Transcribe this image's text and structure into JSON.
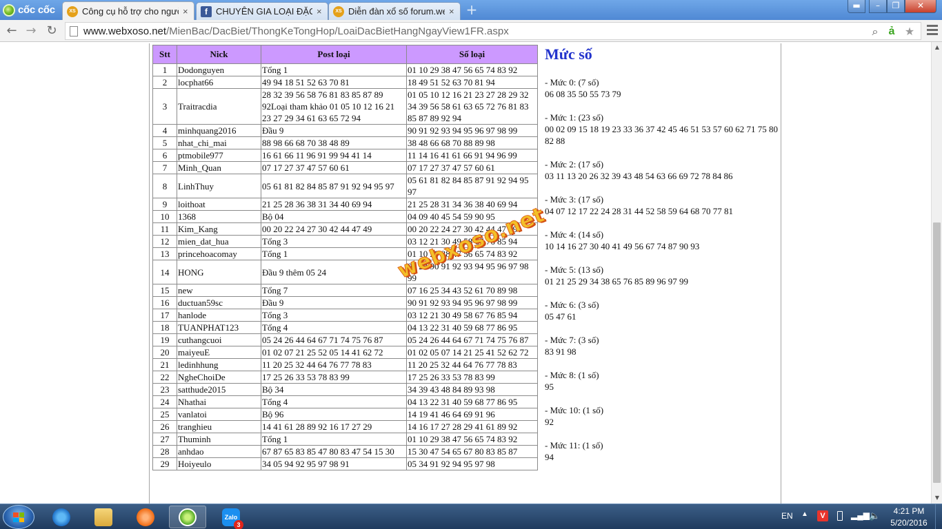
{
  "browser": {
    "brand": "cốc cốc",
    "tabs": [
      {
        "title": "Công cụ hỗ trợ cho người",
        "favicon": "XS",
        "active": true
      },
      {
        "title": "CHUYÊN GIA LOẠI ĐẶC BI",
        "favicon": "f",
        "active": false
      },
      {
        "title": "Diễn đàn xổ số forum.web",
        "favicon": "XS",
        "active": false
      }
    ],
    "url_host": "www.webxoso.net",
    "url_path": "/MienBac/DacBiet/ThongKeTongHop/LoaiDacBietHangNgayView1FR.aspx"
  },
  "table": {
    "headers": [
      "Stt",
      "Nick",
      "Post loại",
      "Số loại"
    ],
    "rows": [
      {
        "stt": "1",
        "nick": "Dodonguyen",
        "post": "Tổng 1",
        "so": "01 10 29 38 47 56 65 74 83 92"
      },
      {
        "stt": "2",
        "nick": "locphat66",
        "post": "49 94 18 51 52 63 70 81",
        "so": "18 49 51 52 63 70 81 94"
      },
      {
        "stt": "3",
        "nick": "Traitracdia",
        "post": "28 32 39 56 58 76 81 83 85 87 89 92Loại tham khảo 01 05 10 12 16 21 23 27 29 34 61 63 65 72 94",
        "so": "01 05 10 12 16 21 23 27 28 29 32 34 39 56 58 61 63 65 72 76 81 83 85 87 89 92 94"
      },
      {
        "stt": "4",
        "nick": "minhquang2016",
        "post": "Đầu 9",
        "so": "90 91 92 93 94 95 96 97 98 99"
      },
      {
        "stt": "5",
        "nick": "nhat_chi_mai",
        "post": "88 98 66 68 70 38 48 89",
        "so": "38 48 66 68 70 88 89 98"
      },
      {
        "stt": "6",
        "nick": "ptmobile977",
        "post": "16 61 66 11 96 91 99 94 41 14",
        "so": "11 14 16 41 61 66 91 94 96 99"
      },
      {
        "stt": "7",
        "nick": "Minh_Quan",
        "post": "07 17 27 37 47 57 60 61",
        "so": "07 17 27 37 47 57 60 61"
      },
      {
        "stt": "8",
        "nick": "LinhThuy",
        "post": "05 61 81 82 84 85 87 91 92 94 95 97",
        "so": "05 61 81 82 84 85 87 91 92 94 95 97"
      },
      {
        "stt": "9",
        "nick": "loithoat",
        "post": "21 25 28 36 38 31 34 40 69 94",
        "so": "21 25 28 31 34 36 38 40 69 94"
      },
      {
        "stt": "10",
        "nick": "1368",
        "post": "Bộ 04",
        "so": "04 09 40 45 54 59 90 95"
      },
      {
        "stt": "11",
        "nick": "Kim_Kang",
        "post": "00 20 22 24 27 30 42 44 47 49",
        "so": "00 20 22 24 27 30 42 44 47 49"
      },
      {
        "stt": "12",
        "nick": "mien_dat_hua",
        "post": "Tổng 3",
        "so": "03 12 21 30 49 58 67 76 85 94"
      },
      {
        "stt": "13",
        "nick": "princehoacomay",
        "post": "Tổng 1",
        "so": "01 10 29 38 47 56 65 74 83 92"
      },
      {
        "stt": "14",
        "nick": "HONG",
        "post": "Đầu 9 thêm 05 24",
        "so": "05 24 90 91 92 93 94 95 96 97 98 99"
      },
      {
        "stt": "15",
        "nick": "new",
        "post": "Tổng 7",
        "so": "07 16 25 34 43 52 61 70 89 98"
      },
      {
        "stt": "16",
        "nick": "ductuan59sc",
        "post": "Đầu 9",
        "so": "90 91 92 93 94 95 96 97 98 99"
      },
      {
        "stt": "17",
        "nick": "hanlode",
        "post": "Tổng 3",
        "so": "03 12 21 30 49 58 67 76 85 94"
      },
      {
        "stt": "18",
        "nick": "TUANPHAT123",
        "post": "Tổng 4",
        "so": "04 13 22 31 40 59 68 77 86 95"
      },
      {
        "stt": "19",
        "nick": "cuthangcuoi",
        "post": "05 24 26 44 64 67 71 74 75 76 87",
        "so": "05 24 26 44 64 67 71 74 75 76 87"
      },
      {
        "stt": "20",
        "nick": "maiyeuE",
        "post": "01 02 07 21 25 52 05 14 41 62 72",
        "so": "01 02 05 07 14 21 25 41 52 62 72"
      },
      {
        "stt": "21",
        "nick": "ledinhhung",
        "post": "11 20 25 32 44 64 76 77 78 83",
        "so": "11 20 25 32 44 64 76 77 78 83"
      },
      {
        "stt": "22",
        "nick": "NgheChoiDe",
        "post": "17 25 26 33 53 78 83 99",
        "so": "17 25 26 33 53 78 83 99"
      },
      {
        "stt": "23",
        "nick": "satthude2015",
        "post": "Bộ 34",
        "so": "34 39 43 48 84 89 93 98"
      },
      {
        "stt": "24",
        "nick": "Nhathai",
        "post": "Tổng 4",
        "so": "04 13 22 31 40 59 68 77 86 95"
      },
      {
        "stt": "25",
        "nick": "vanlatoi",
        "post": "Bộ 96",
        "so": "14 19 41 46 64 69 91 96"
      },
      {
        "stt": "26",
        "nick": "tranghieu",
        "post": "14 41 61 28 89 92 16 17 27 29",
        "so": "14 16 17 27 28 29 41 61 89 92"
      },
      {
        "stt": "27",
        "nick": "Thuminh",
        "post": "Tổng 1",
        "so": "01 10 29 38 47 56 65 74 83 92"
      },
      {
        "stt": "28",
        "nick": "anhdao",
        "post": "67 87 65 83 85 47 80 83 47 54 15 30",
        "so": "15 30 47 54 65 67 80 83 85 87"
      },
      {
        "stt": "29",
        "nick": "Hoiyeulo",
        "post": "34 05 94 92 95 97 98 91",
        "so": "05 34 91 92 94 95 97 98"
      }
    ]
  },
  "muc": {
    "title": "Mức số",
    "items": [
      {
        "label": "- Mức 0: (7 số)",
        "numbers": "06 08 35 50 55 73 79"
      },
      {
        "label": "- Mức 1: (23 số)",
        "numbers": "00 02 09 15 18 19 23 33 36 37 42 45 46 51 53 57 60 62 71 75 80 82 88"
      },
      {
        "label": "- Mức 2: (17 số)",
        "numbers": "03 11 13 20 26 32 39 43 48 54 63 66 69 72 78 84 86"
      },
      {
        "label": "- Mức 3: (17 số)",
        "numbers": "04 07 12 17 22 24 28 31 44 52 58 59 64 68 70 77 81"
      },
      {
        "label": "- Mức 4: (14 số)",
        "numbers": "10 14 16 27 30 40 41 49 56 67 74 87 90 93"
      },
      {
        "label": "- Mức 5: (13 số)",
        "numbers": "01 21 25 29 34 38 65 76 85 89 96 97 99"
      },
      {
        "label": "- Mức 6: (3 số)",
        "numbers": "05 47 61"
      },
      {
        "label": "- Mức 7: (3 số)",
        "numbers": "83 91 98"
      },
      {
        "label": "- Mức 8: (1 số)",
        "numbers": "95"
      },
      {
        "label": "- Mức 10: (1 số)",
        "numbers": "92"
      },
      {
        "label": "- Mức 11: (1 số)",
        "numbers": "94"
      }
    ]
  },
  "watermark": "webxoso.net",
  "taskbar": {
    "zalo_label": "Zalo",
    "zalo_badge": "3",
    "lang": "EN",
    "time": "4:21 PM",
    "date": "5/20/2016"
  },
  "icons": {
    "back": "arrow-left-icon",
    "forward": "arrow-right-icon",
    "reload": "reload-icon",
    "zoom": "search-icon",
    "star": "star-icon",
    "menu": "hamburger-menu-icon"
  }
}
